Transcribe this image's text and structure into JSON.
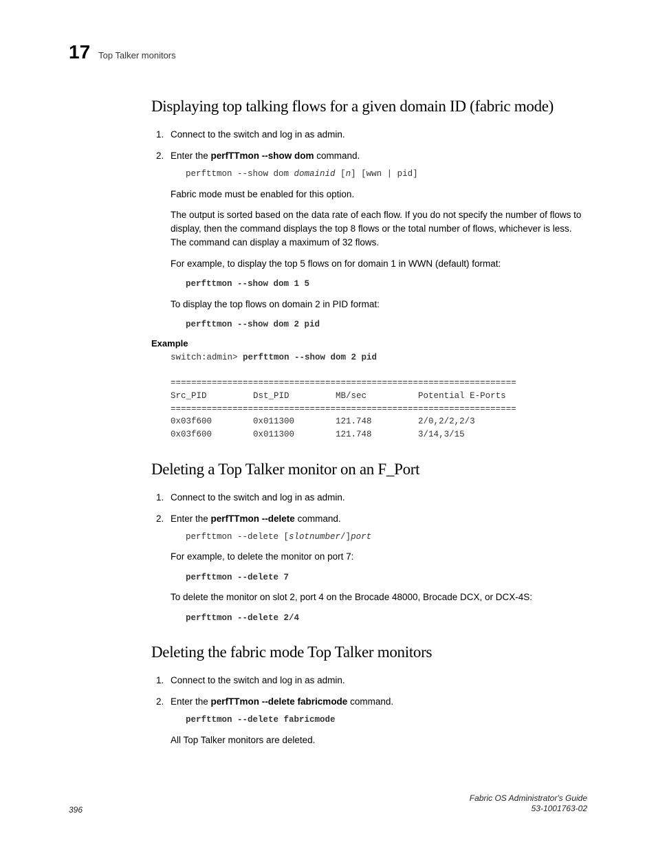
{
  "header": {
    "chapter_number": "17",
    "breadcrumb": "Top Talker monitors"
  },
  "section1": {
    "title": "Displaying top talking flows for a given domain ID (fabric mode)",
    "step1": "Connect to the switch and log in as admin.",
    "step2_pre": "Enter the ",
    "step2_cmd": "perfTTmon --show dom",
    "step2_post": " command.",
    "code1_a": "perfttmon --show dom ",
    "code1_b": "domainid",
    "code1_c": " [",
    "code1_d": "n",
    "code1_e": "] [wwn | pid]",
    "p1": "Fabric mode must be enabled for this option.",
    "p2": "The output is sorted based on the data rate of each flow. If you do not specify the number of flows to display, then the command displays the top 8 flows or the total number of flows, whichever is less. The command can display a maximum of 32 flows.",
    "p3": "For example, to display the top 5 flows on for domain 1 in WWN (default) format:",
    "code2": "perfttmon --show dom 1 5",
    "p4": "To display the top flows on domain 2 in PID format:",
    "code3": "perfttmon --show dom 2 pid",
    "example_label": "Example",
    "example_prompt": "switch:admin> ",
    "example_cmd": "perfttmon --show dom 2 pid",
    "example_out": "===================================================================\nSrc_PID         Dst_PID         MB/sec          Potential E-Ports\n===================================================================\n0x03f600        0x011300        121.748         2/0,2/2,2/3\n0x03f600        0x011300        121.748         3/14,3/15"
  },
  "section2": {
    "title": "Deleting a Top Talker monitor on an F_Port",
    "step1": "Connect to the switch and log in as admin.",
    "step2_pre": "Enter the ",
    "step2_cmd": "perfTTmon --delete",
    "step2_post": " command.",
    "code1_a": "perfttmon --delete [",
    "code1_b": "slotnumber",
    "code1_c": "/]",
    "code1_d": "port",
    "p1": "For example, to delete the monitor on port 7:",
    "code2": "perfttmon --delete 7",
    "p2": "To delete the monitor on slot 2, port 4 on the Brocade 48000, Brocade DCX, or DCX-4S:",
    "code3": "perfttmon --delete 2/4"
  },
  "section3": {
    "title": "Deleting the fabric mode Top Talker monitors",
    "step1": "Connect to the switch and log in as admin.",
    "step2_pre": "Enter the ",
    "step2_cmd": "perfTTmon --delete fabricmode",
    "step2_post": " command.",
    "code1": "perfttmon --delete fabricmode",
    "p1": "All Top Talker monitors are deleted."
  },
  "footer": {
    "page_number": "396",
    "guide_title": "Fabric OS Administrator's Guide",
    "doc_number": "53-1001763-02"
  }
}
